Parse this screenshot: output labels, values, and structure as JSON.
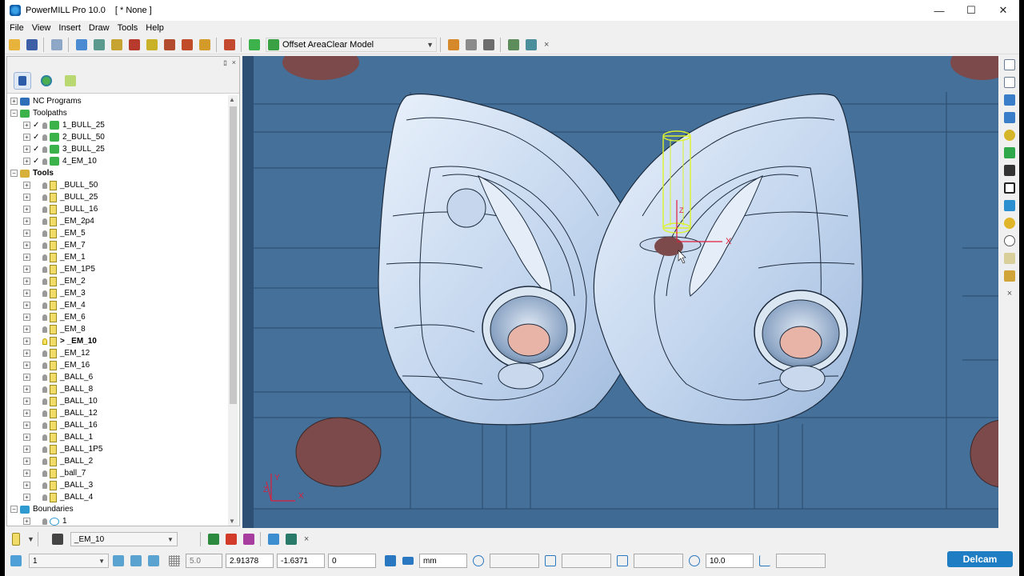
{
  "window": {
    "title": "PowerMILL Pro 10.0",
    "project": "[ * None ]",
    "min": "—",
    "max": "☐",
    "close": "✕"
  },
  "menu": [
    "File",
    "View",
    "Insert",
    "Draw",
    "Tools",
    "Help"
  ],
  "toolbar": {
    "strategy_label": "Offset AreaClear Model",
    "close": "×"
  },
  "explorer": {
    "header_pin": "ﾛ",
    "header_close": "×",
    "items": [
      {
        "label": "NC Programs",
        "indent": 0,
        "exp": "+",
        "kind": "folder"
      },
      {
        "label": "Toolpaths",
        "indent": 0,
        "exp": "−",
        "kind": "folder-green"
      },
      {
        "label": "1_BULL_25",
        "indent": 1,
        "exp": "+",
        "kind": "toolpath",
        "check": "✓"
      },
      {
        "label": "2_BULL_50",
        "indent": 1,
        "exp": "+",
        "kind": "toolpath",
        "check": "✓"
      },
      {
        "label": "3_BULL_25",
        "indent": 1,
        "exp": "+",
        "kind": "toolpath",
        "check": "✓"
      },
      {
        "label": "4_EM_10",
        "indent": 1,
        "exp": "+",
        "kind": "toolpath",
        "check": "✓"
      },
      {
        "label": "Tools",
        "indent": 0,
        "exp": "−",
        "kind": "folder-tools",
        "bold": true
      },
      {
        "label": "_BULL_50",
        "indent": 1,
        "exp": "+",
        "kind": "tool"
      },
      {
        "label": "_BULL_25",
        "indent": 1,
        "exp": "+",
        "kind": "tool"
      },
      {
        "label": "_BULL_16",
        "indent": 1,
        "exp": "+",
        "kind": "tool"
      },
      {
        "label": "_EM_2p4",
        "indent": 1,
        "exp": "+",
        "kind": "tool"
      },
      {
        "label": "_EM_5",
        "indent": 1,
        "exp": "+",
        "kind": "tool"
      },
      {
        "label": "_EM_7",
        "indent": 1,
        "exp": "+",
        "kind": "tool"
      },
      {
        "label": "_EM_1",
        "indent": 1,
        "exp": "+",
        "kind": "tool"
      },
      {
        "label": "_EM_1P5",
        "indent": 1,
        "exp": "+",
        "kind": "tool"
      },
      {
        "label": "_EM_2",
        "indent": 1,
        "exp": "+",
        "kind": "tool"
      },
      {
        "label": "_EM_3",
        "indent": 1,
        "exp": "+",
        "kind": "tool"
      },
      {
        "label": "_EM_4",
        "indent": 1,
        "exp": "+",
        "kind": "tool"
      },
      {
        "label": "_EM_6",
        "indent": 1,
        "exp": "+",
        "kind": "tool"
      },
      {
        "label": "_EM_8",
        "indent": 1,
        "exp": "+",
        "kind": "tool"
      },
      {
        "label": "> _EM_10",
        "indent": 1,
        "exp": "+",
        "kind": "tool",
        "bold": true,
        "active": true
      },
      {
        "label": "_EM_12",
        "indent": 1,
        "exp": "+",
        "kind": "tool"
      },
      {
        "label": "_EM_16",
        "indent": 1,
        "exp": "+",
        "kind": "tool"
      },
      {
        "label": "_BALL_6",
        "indent": 1,
        "exp": "+",
        "kind": "tool"
      },
      {
        "label": "_BALL_8",
        "indent": 1,
        "exp": "+",
        "kind": "tool"
      },
      {
        "label": "_BALL_10",
        "indent": 1,
        "exp": "+",
        "kind": "tool"
      },
      {
        "label": "_BALL_12",
        "indent": 1,
        "exp": "+",
        "kind": "tool"
      },
      {
        "label": "_BALL_16",
        "indent": 1,
        "exp": "+",
        "kind": "tool"
      },
      {
        "label": "_BALL_1",
        "indent": 1,
        "exp": "+",
        "kind": "tool"
      },
      {
        "label": "_BALL_1P5",
        "indent": 1,
        "exp": "+",
        "kind": "tool"
      },
      {
        "label": "_BALL_2",
        "indent": 1,
        "exp": "+",
        "kind": "tool"
      },
      {
        "label": "_ball_7",
        "indent": 1,
        "exp": "+",
        "kind": "tool"
      },
      {
        "label": "_BALL_3",
        "indent": 1,
        "exp": "+",
        "kind": "tool"
      },
      {
        "label": "_BALL_4",
        "indent": 1,
        "exp": "+",
        "kind": "tool"
      },
      {
        "label": "Boundaries",
        "indent": 0,
        "exp": "−",
        "kind": "folder-boundary"
      },
      {
        "label": "1",
        "indent": 1,
        "exp": "+",
        "kind": "boundary"
      }
    ]
  },
  "viewport": {
    "axis_x": "X",
    "axis_y": "Y",
    "axis_z": "Z",
    "bg": "#44709a"
  },
  "bottom1": {
    "tool_select": "_EM_10",
    "close": "×"
  },
  "bottom2": {
    "workplane": "1",
    "grid": "5.0",
    "x": "2.91378",
    "y": "-1.6371",
    "z": "0",
    "units": "mm",
    "tolerance": "10.0",
    "brand": "Delcam"
  }
}
